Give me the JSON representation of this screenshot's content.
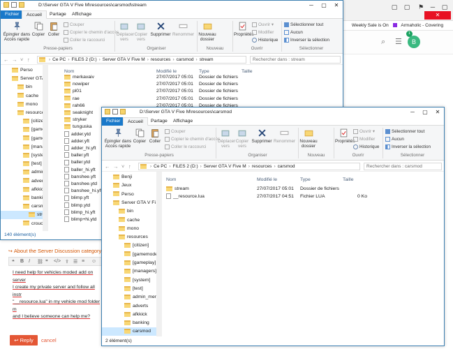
{
  "browser": {
    "bookmarks": [
      "Weekly Sale is On",
      "Armaholic - Covering"
    ],
    "avatar_letter": "B",
    "notif_count": "1",
    "forum": {
      "topic_title": "About the Server Discussion category",
      "body_lines": [
        "I need help for vehicles moded add on server",
        "I create my private server and follow all instr",
        "\"__resource.lua\" in my vehicle mod folder m",
        "and I believe someone can help me?"
      ],
      "reply_label": "Reply",
      "cancel_label": "cancel"
    },
    "accent_color": "#e45735"
  },
  "ribbon_labels": {
    "file": "Fichier",
    "home": "Accueil",
    "share": "Partage",
    "view": "Affichage",
    "pin": "Épingler dans Accès rapide",
    "copy": "Copier",
    "paste": "Coller",
    "cut": "Couper",
    "copy_path": "Copier le chemin d'accès",
    "paste_shortcut": "Coller le raccourci",
    "move_to": "Déplacer vers",
    "copy_to": "Copier vers",
    "delete": "Supprimer",
    "rename": "Renommer",
    "new_folder": "Nouveau dossier",
    "properties": "Propriétés",
    "open": "Ouvrir",
    "edit": "Modifier",
    "history": "Historique",
    "select_all": "Sélectionner tout",
    "select_none": "Aucun",
    "invert": "Inverser la sélection",
    "g_clipboard": "Presse-papiers",
    "g_organize": "Organiser",
    "g_new": "Nouveau",
    "g_open": "Ouvrir",
    "g_select": "Sélectionner"
  },
  "columns": {
    "name": "Nom",
    "modified": "Modifié le",
    "type": "Type",
    "size": "Taille"
  },
  "window_back": {
    "title": "D:\\Server GTA V Five M\\resources\\carsmod\\stream",
    "address": [
      "Ce PC",
      "FILES 2 (D:)",
      "Server GTA V Five M",
      "resources",
      "carsmod",
      "stream"
    ],
    "search_placeholder": "Rechercher dans : stream",
    "nav": [
      "Perso",
      "Server GTA V Fi",
      "bin",
      "cache",
      "mono",
      "resources",
      "[citizen]",
      "[gamemode",
      "[gameplay]",
      "[managers]",
      "[system]",
      "[test]",
      "admin_men",
      "adverts",
      "afkkick",
      "banking",
      "carsmod",
      "stream",
      "crouch"
    ],
    "files": [
      {
        "name": "merkavaiv",
        "modified": "27/07/2017 05:01",
        "type": "Dossier de fichiers"
      },
      {
        "name": "nowiper",
        "modified": "27/07/2017 05:01",
        "type": "Dossier de fichiers"
      },
      {
        "name": "pl01",
        "modified": "27/07/2017 05:01",
        "type": "Dossier de fichiers"
      },
      {
        "name": "rae",
        "modified": "27/07/2017 05:01",
        "type": "Dossier de fichiers"
      },
      {
        "name": "rah66",
        "modified": "27/07/2017 05:01",
        "type": "Dossier de fichiers"
      },
      {
        "name": "seaknight",
        "modified": "",
        "type": ""
      },
      {
        "name": "stryker",
        "modified": "",
        "type": ""
      },
      {
        "name": "tunguska",
        "modified": "",
        "type": ""
      },
      {
        "name": "adder.ytd",
        "modified": "",
        "type": ""
      },
      {
        "name": "adder.yft",
        "modified": "",
        "type": ""
      },
      {
        "name": "adder_hi.yft",
        "modified": "",
        "type": ""
      },
      {
        "name": "baller.yft",
        "modified": "",
        "type": ""
      },
      {
        "name": "baller.ytd",
        "modified": "",
        "type": ""
      },
      {
        "name": "baller_hi.yft",
        "modified": "",
        "type": ""
      },
      {
        "name": "banshee.yft",
        "modified": "",
        "type": ""
      },
      {
        "name": "banshee.ytd",
        "modified": "",
        "type": ""
      },
      {
        "name": "banshee_hi.yft",
        "modified": "",
        "type": ""
      },
      {
        "name": "blimp.yft",
        "modified": "",
        "type": ""
      },
      {
        "name": "blimp.ytd",
        "modified": "",
        "type": ""
      },
      {
        "name": "blimp_hi.yft",
        "modified": "",
        "type": ""
      },
      {
        "name": "blimp+hi.ytd",
        "modified": "",
        "type": ""
      }
    ],
    "status": "140 élément(s)"
  },
  "window_front": {
    "title": "D:\\Server GTA V Five M\\resources\\carsmod",
    "address": [
      "Ce PC",
      "FILES 2 (D:)",
      "Server GTA V Five M",
      "resources",
      "carsmod"
    ],
    "search_placeholder": "Rechercher dans : carsmod",
    "nav": [
      "Benji",
      "Jeux",
      "Perso",
      "Server GTA V Fi",
      "bin",
      "cache",
      "mono",
      "resources",
      "[citizen]",
      "[gamemode",
      "[gameplay]",
      "[managers]",
      "[system]",
      "[test]",
      "admin_men",
      "adverts",
      "afkkick",
      "banking",
      "carsmod"
    ],
    "files": [
      {
        "name": "stream",
        "modified": "27/07/2017 05:01",
        "type": "Dossier de fichiers",
        "size": ""
      },
      {
        "name": "__resource.lua",
        "modified": "27/07/2017 04:51",
        "type": "Fichier LUA",
        "size": "0 Ko"
      }
    ],
    "status": "2 élément(s)"
  }
}
